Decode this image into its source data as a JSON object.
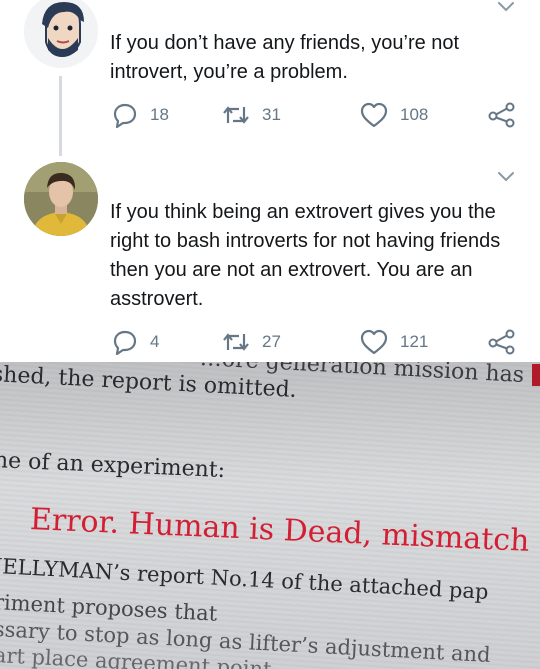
{
  "tweets": [
    {
      "avatar_icon": "cartoon-face-icon",
      "text": "If you don’t have any friends, you’re not introvert, you’re a problem.",
      "replies": "18",
      "retweets": "31",
      "likes": "108"
    },
    {
      "avatar_icon": "person-photo-icon",
      "text": "If you think being an extrovert gives you the right to bash introverts for not having friends then you are not an extrovert. You are an asstrovert.",
      "replies": "4",
      "retweets": "27",
      "likes": "121"
    }
  ],
  "photo": {
    "lines": [
      "…ore generation mission has",
      "shed, the report is omitted.",
      "ne of an experiment:",
      "Error. Human is Dead, mismatch",
      "JELLYMAN’s report No.14 of the attached pap",
      "riment proposes that",
      "ssary to stop as long as lifter’s adjustment and",
      "art place agreement point"
    ]
  },
  "colors": {
    "text": "#14171a",
    "muted": "#657786",
    "error_red": "#d21f33",
    "connector": "#d6dadf"
  }
}
